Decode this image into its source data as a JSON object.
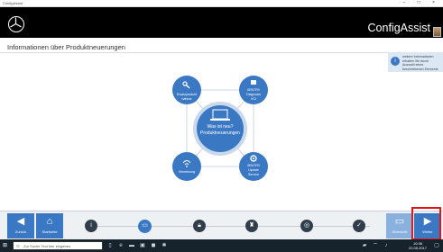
{
  "window": {
    "title": "ConfigAssist",
    "controls": "– □ ×"
  },
  "header": {
    "brand": "ConfigAssist"
  },
  "page": {
    "title": "Informationen über Produktneuerungen"
  },
  "info_panel": {
    "text": "weitere Informationen erhalten Sie durch Auswahl eines beschriebenen Elements"
  },
  "center": {
    "line1": "Was ist neu?",
    "line2": "Produktneuerungen",
    "icon": "laptop-icon"
  },
  "nodes": [
    {
      "label1": "Ersatzprodukt",
      "label2": "nahme",
      "icon": "wrench-icon"
    },
    {
      "label1": "XENTRY",
      "label2": "Diagnosis",
      "label3": "VCI",
      "icon": "plug-icon"
    },
    {
      "label1": "Vernetzung",
      "label2": "",
      "icon": "wifi-icon"
    },
    {
      "label1": "XENTRY",
      "label2": "Update",
      "label3": "Service",
      "icon": "gear-icon"
    }
  ],
  "bottom": {
    "back_label": "Zurück",
    "home_label": "Startseite",
    "prev_label": "Übersicht",
    "next_label": "Weiter"
  },
  "steps": [
    {
      "icon": "info-icon",
      "active": false
    },
    {
      "icon": "display-icon",
      "active": true
    },
    {
      "icon": "lock-icon",
      "active": false
    },
    {
      "icon": "person-icon",
      "active": false
    },
    {
      "icon": "network-icon",
      "active": false
    },
    {
      "icon": "check-icon",
      "active": false
    }
  ],
  "taskbar": {
    "search_placeholder": "Zur Suche Text hier eingeben",
    "time": "10:36",
    "date": "22.05.2017"
  },
  "colors": {
    "accent": "#3b78c4",
    "node": "#3b78c4",
    "header": "#000000",
    "highlight": "#e01818"
  }
}
